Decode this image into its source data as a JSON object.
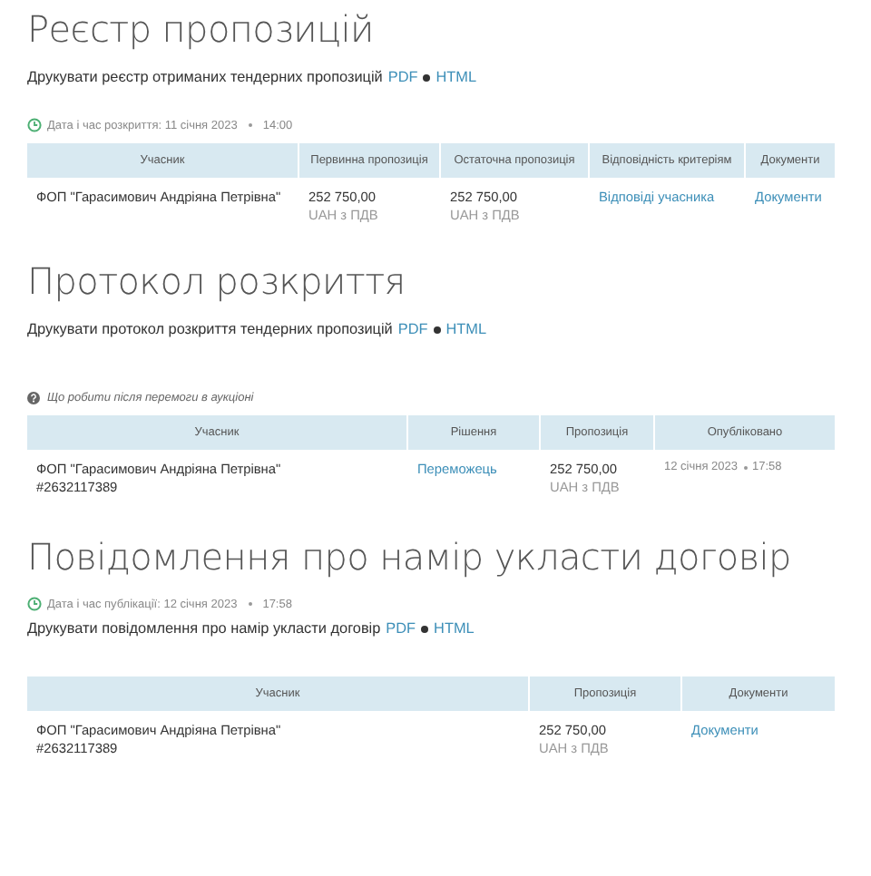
{
  "sections": [
    {
      "title": "Реєстр пропозицій",
      "blocks": [
        {
          "kind": "print",
          "text": "Друкувати реєстр отриманих тендерних пропозицій",
          "links": [
            "PDF",
            "HTML"
          ]
        },
        {
          "kind": "clock",
          "text": "Дата і час розкриття: 11 січня 2023",
          "time": "14:00"
        }
      ],
      "table": {
        "columns": [
          "Учасник",
          "Первинна пропозиція",
          "Остаточна пропозиція",
          "Відповідність критеріям",
          "Документи"
        ],
        "rows": [
          {
            "cells": [
              {
                "kind": "text",
                "text": "ФОП \"Гарасимович Андріяна Петрівна\""
              },
              {
                "kind": "amount",
                "text": "252 750,00",
                "note": "UAH з ПДВ"
              },
              {
                "kind": "amount",
                "text": "252 750,00",
                "note": "UAH з ПДВ"
              },
              {
                "kind": "link",
                "text": "Відповіді учасника"
              },
              {
                "kind": "link",
                "text": "Документи"
              }
            ]
          }
        ]
      }
    },
    {
      "title": "Протокол розкриття",
      "blocks": [
        {
          "kind": "print",
          "text": "Друкувати протокол розкриття тендерних пропозицій",
          "links": [
            "PDF",
            "HTML"
          ]
        },
        {
          "kind": "help",
          "text": "Що робити після перемоги в аукціоні"
        }
      ],
      "table": {
        "columns": [
          "Учасник",
          "Рішення",
          "Пропозиція",
          "Опубліковано"
        ],
        "rows": [
          {
            "cells": [
              {
                "kind": "text",
                "text": "ФОП \"Гарасимович Андріяна Петрівна\"",
                "note": "#2632117389"
              },
              {
                "kind": "link",
                "text": "Переможець"
              },
              {
                "kind": "amount",
                "text": "252 750,00",
                "note": "UAH з ПДВ"
              },
              {
                "kind": "datetime",
                "text": "12 січня 2023",
                "time": "17:58"
              }
            ]
          }
        ]
      }
    },
    {
      "title": "Повідомлення про намір укласти договір",
      "blocks": [
        {
          "kind": "clock",
          "text": "Дата і час публікації: 12 січня 2023",
          "time": "17:58"
        },
        {
          "kind": "print",
          "text": "Друкувати повідомлення про намір укласти договір",
          "links": [
            "PDF",
            "HTML"
          ]
        }
      ],
      "table": {
        "columns": [
          "Учасник",
          "Пропозиція",
          "Документи"
        ],
        "rows": [
          {
            "cells": [
              {
                "kind": "text",
                "text": "ФОП \"Гарасимович Андріяна Петрівна\"",
                "note": "#2632117389"
              },
              {
                "kind": "amount",
                "text": "252 750,00",
                "note": "UAH з ПДВ"
              },
              {
                "kind": "link",
                "text": "Документи"
              }
            ]
          }
        ]
      }
    }
  ]
}
